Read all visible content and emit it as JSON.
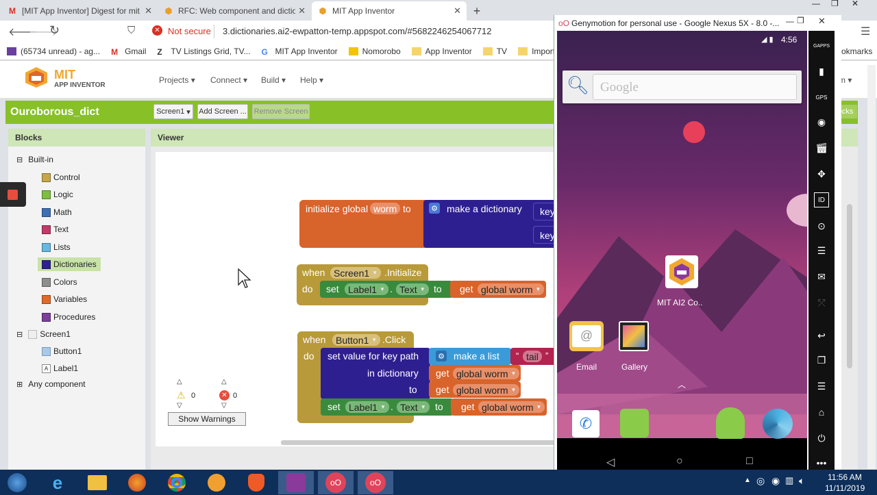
{
  "browser": {
    "tabs": [
      {
        "title": "[MIT App Inventor] Digest for mit",
        "icon": "gmail-icon"
      },
      {
        "title": "RFC: Web component and diction",
        "icon": "appinventor-icon"
      },
      {
        "title": "MIT App Inventor",
        "icon": "appinventor-icon"
      }
    ],
    "new_tab": "+",
    "security": "Not secure",
    "url": "3.dictionaries.ai2-ewpatton-temp.appspot.com/#5682246254067712",
    "bookmarks": [
      "(65734 unread) - ag...",
      "Gmail",
      "TV Listings Grid, TV...",
      "MIT App Inventor",
      "Nomorobo",
      "App Inventor",
      "TV",
      "Importe"
    ],
    "bookmarks_right": "okmarks"
  },
  "app": {
    "logo_line1": "MIT",
    "logo_line2": "APP INVENTOR",
    "menu": [
      "Projects",
      "Connect",
      "Build",
      "Help"
    ],
    "menu_right": "m",
    "project_name": "Ouroborous_dict",
    "screen_select": "Screen1",
    "add_screen": "Add Screen ...",
    "remove_screen": "Remove Screen",
    "blocks_btn": "ocks",
    "blocks_heading": "Blocks",
    "viewer_heading": "Viewer",
    "builtin": "Built-in",
    "categories": [
      {
        "label": "Control",
        "color": "#c8a64a"
      },
      {
        "label": "Logic",
        "color": "#7fbf3f"
      },
      {
        "label": "Math",
        "color": "#3f6fb5"
      },
      {
        "label": "Text",
        "color": "#c23a6a"
      },
      {
        "label": "Lists",
        "color": "#66b8e0"
      },
      {
        "label": "Dictionaries",
        "color": "#2e1f90"
      },
      {
        "label": "Colors",
        "color": "#8e8e8e"
      },
      {
        "label": "Variables",
        "color": "#e06a2a"
      },
      {
        "label": "Procedures",
        "color": "#7c3f9b"
      }
    ],
    "screen": "Screen1",
    "components": [
      "Button1",
      "Label1"
    ],
    "any_component": "Any component",
    "warnings_count": "0",
    "errors_count": "0",
    "show_warnings": "Show Warnings"
  },
  "blocks": {
    "init_global": "initialize global",
    "var_worm": "worm",
    "to": "to",
    "make_dict": "make a dictionary",
    "key": "key",
    "when": "when",
    "do": "do",
    "screen1": "Screen1",
    "initialize_event": ".Initialize",
    "set": "set",
    "label1": "Label1",
    "dot": ".",
    "text_prop": "Text",
    "get": "get",
    "global_worm": "global worm",
    "button1": "Button1",
    "click_event": ".Click",
    "set_value_path": "set value for key path",
    "make_list": "make a list",
    "tail": "tail",
    "in_dictionary": "in dictionary"
  },
  "genymotion": {
    "title": "Genymotion for personal use - Google Nexus 5X - 8.0 -...",
    "time": "4:56",
    "google_placeholder": "Google",
    "apps": [
      "MIT AI2 Co..",
      "Email",
      "Gallery"
    ],
    "side_labels": [
      "GAPPS",
      "GPS",
      "ID"
    ]
  },
  "taskbar": {
    "time": "11:56 AM",
    "date": "11/11/2019"
  },
  "colors": {
    "dict_purple": "#2e1f90",
    "variable_orange": "#d8632b",
    "event_gold": "#b89a3a",
    "component_green": "#3a8a3d",
    "list_blue": "#3a9bd8",
    "text_red": "#b2234f",
    "project_bar": "#88c028"
  }
}
